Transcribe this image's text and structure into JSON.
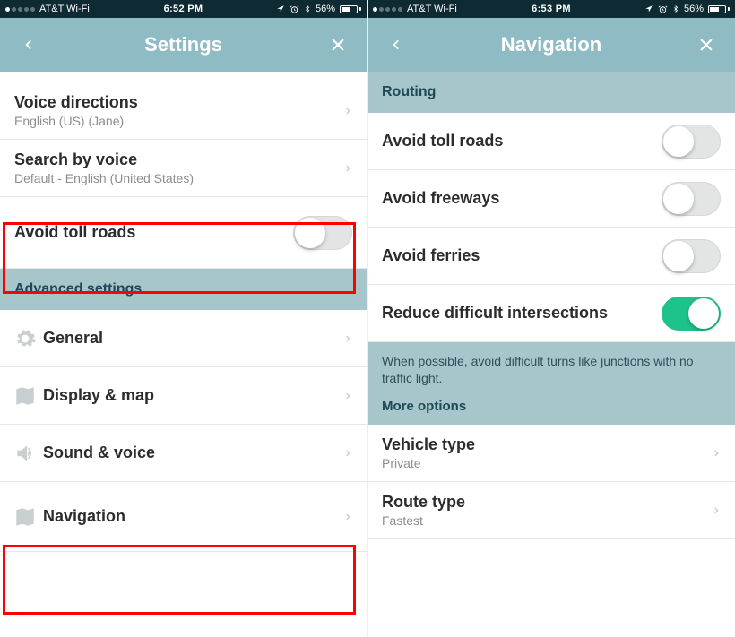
{
  "left": {
    "status": {
      "carrier": "AT&T Wi-Fi",
      "time": "6:52 PM",
      "battery": "56%"
    },
    "header": {
      "title": "Settings"
    },
    "rows": {
      "voice": {
        "title": "Voice directions",
        "sub": "English (US) (Jane)"
      },
      "search": {
        "title": "Search by voice",
        "sub": "Default - English (United States)"
      },
      "toll": {
        "title": "Avoid toll roads"
      }
    },
    "section_advanced": "Advanced settings",
    "adv": {
      "general": "General",
      "display": "Display & map",
      "sound": "Sound & voice",
      "navigation": "Navigation"
    }
  },
  "right": {
    "status": {
      "carrier": "AT&T Wi-Fi",
      "time": "6:53 PM",
      "battery": "56%"
    },
    "header": {
      "title": "Navigation"
    },
    "section_routing": "Routing",
    "toggles": {
      "toll": "Avoid toll roads",
      "freeways": "Avoid freeways",
      "ferries": "Avoid ferries",
      "reduce": "Reduce difficult intersections"
    },
    "info": "When possible, avoid difficult turns like junctions with no traffic light.",
    "more": "More options",
    "vehicle": {
      "title": "Vehicle type",
      "sub": "Private"
    },
    "route": {
      "title": "Route type",
      "sub": "Fastest"
    }
  }
}
